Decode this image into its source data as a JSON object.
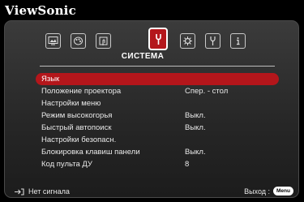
{
  "brand": "ViewSonic",
  "tabs": [
    {
      "icon": "picture-icon"
    },
    {
      "icon": "palette-icon"
    },
    {
      "icon": "touch-icon"
    },
    {
      "icon": "wrench-icon",
      "active": true
    },
    {
      "icon": "gear-icon"
    },
    {
      "icon": "tools-icon"
    },
    {
      "icon": "info-icon"
    }
  ],
  "section_title": "СИСТЕМА",
  "menu": [
    {
      "label": "Язык",
      "value": ""
    },
    {
      "label": "Положение проектора",
      "value": "Спер. - стол"
    },
    {
      "label": "Настройки меню",
      "value": ""
    },
    {
      "label": "Режим высокогорья",
      "value": "Выкл."
    },
    {
      "label": "Быстрый автопоиск",
      "value": "Выкл."
    },
    {
      "label": "Настройки безопасн.",
      "value": ""
    },
    {
      "label": "Блокировка клавиш панели",
      "value": "Выкл."
    },
    {
      "label": "Код пульта ДУ",
      "value": "8"
    }
  ],
  "footer": {
    "signal": "Нет сигнала",
    "exit": "Выход :",
    "menu_key": "Menu"
  }
}
